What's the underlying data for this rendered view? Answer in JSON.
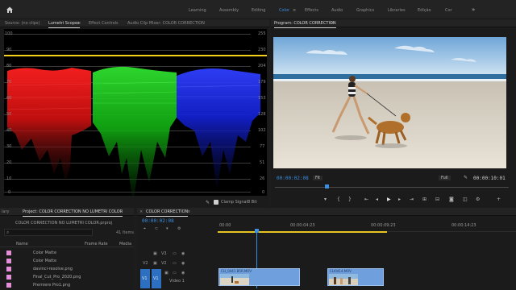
{
  "workspaces": {
    "items": [
      "Learning",
      "Assembly",
      "Editing",
      "Color",
      "Effects",
      "Audio",
      "Graphics",
      "Libraries",
      "Edição",
      "Cor"
    ],
    "active": "Color",
    "more": "»"
  },
  "source_panel": {
    "tabs": [
      "Source: (no clips)",
      "Lumetri Scopes",
      "Effect Controls",
      "Audio Clip Mixer: COLOR CORRECTION"
    ],
    "active_tab": "Lumetri Scopes",
    "left_ticks": [
      "100",
      "90",
      "80",
      "70",
      "60",
      "50",
      "40",
      "30",
      "20",
      "10",
      "0"
    ],
    "right_ticks": [
      "255",
      "230",
      "204",
      "179",
      "153",
      "128",
      "102",
      "77",
      "51",
      "26",
      "0"
    ],
    "clamp_signal": "Clamp Signal",
    "bit_depth": "8 Bit",
    "parade_colors": {
      "red": "#e01010",
      "green": "#12c412",
      "blue": "#1b2be6",
      "highlight": "#f2d21b"
    }
  },
  "program_monitor": {
    "title": "Program: COLOR CORRECTION",
    "timecode": "00:00:02:08",
    "fit": "Fit",
    "quality": "Full",
    "duration": "00:00:10:01"
  },
  "project_panel": {
    "lib_tab": "lary",
    "tab": "Project: COLOR CORRECTION NO LUMETRI COLOR",
    "project_file": "COLOR CORRECTION NO LUMETRI COLOR.prproj",
    "item_count": "41 Items",
    "columns": [
      "Name",
      "Frame Rate",
      "Media"
    ],
    "items": [
      "Color Matte",
      "Color Matte",
      "davinci-resolve.png",
      "Final_Cut_Pro_2020.png",
      "Premiere Pro1.png"
    ]
  },
  "timeline": {
    "tab": "COLOR CORRECTION",
    "timecode": "00:00:02:08",
    "ruler": [
      "00:00",
      "00:00:04:23",
      "00:00:09:23",
      "00:00:14:23"
    ],
    "tracks": [
      {
        "name": "V3",
        "label": ""
      },
      {
        "name": "V2",
        "label": ""
      },
      {
        "name": "V1",
        "label": "Video 1"
      }
    ],
    "clips": [
      {
        "name": "CLI_0441 B5R.MOV"
      },
      {
        "name": "CLI0414.MOV"
      }
    ]
  }
}
